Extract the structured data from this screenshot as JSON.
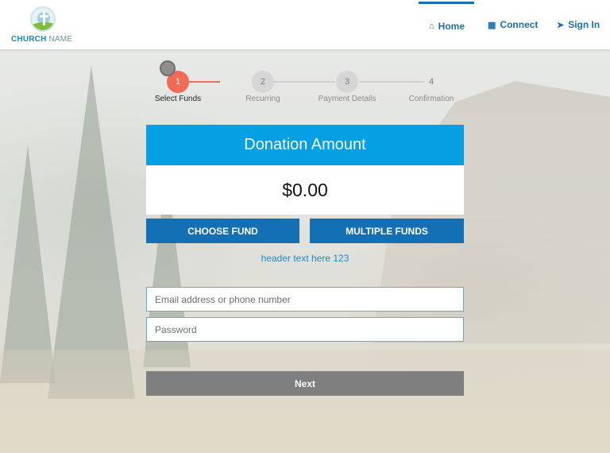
{
  "brand": {
    "logo_text_primary": "CHURCH",
    "logo_text_secondary": "NAME"
  },
  "nav": {
    "items": [
      {
        "label": "Home",
        "icon": "home-icon",
        "active": true
      },
      {
        "label": "Connect",
        "icon": "calendar-icon",
        "active": false
      },
      {
        "label": "Sign In",
        "icon": "sign-in-icon",
        "active": false
      }
    ]
  },
  "stepper": {
    "current_step": 1,
    "steps": [
      {
        "number": "1",
        "label": "Select Funds"
      },
      {
        "number": "2",
        "label": "Recurring"
      },
      {
        "number": "3",
        "label": "Payment Details"
      },
      {
        "number": "4",
        "label": "Confirmation"
      }
    ]
  },
  "donation": {
    "title": "Donation Amount",
    "amount": "$0.00",
    "choose_fund_label": "CHOOSE FUND",
    "multiple_funds_label": "MULTIPLE FUNDS",
    "header_text": "header text here 123"
  },
  "form": {
    "email_placeholder": "Email address or phone number",
    "email_value": "",
    "password_placeholder": "Password",
    "password_value": "",
    "next_label": "Next"
  },
  "colors": {
    "accent_blue": "#05a0e4",
    "button_blue": "#1470b4",
    "active_step": "#f06a55",
    "next_button": "#7f7f7f"
  }
}
